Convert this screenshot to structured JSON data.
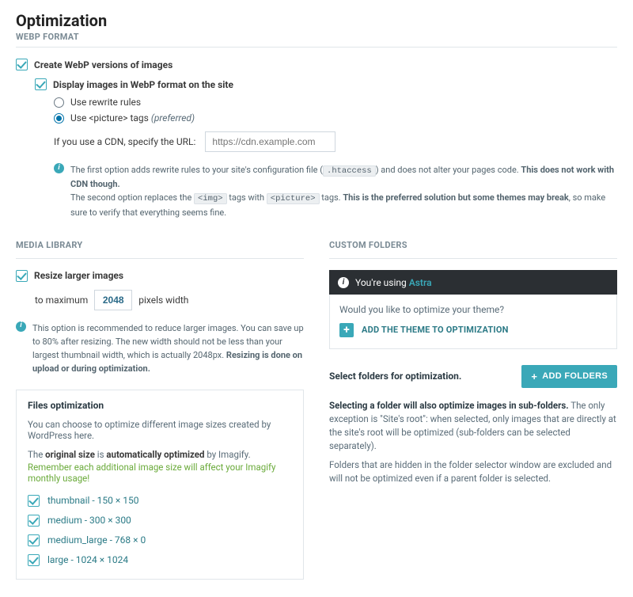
{
  "header": {
    "title": "Optimization",
    "webp_section": "WEBP FORMAT"
  },
  "webp": {
    "create_label": "Create WebP versions of images",
    "display_label": "Display images in WebP format on the site",
    "radio_rewrite": "Use rewrite rules",
    "radio_picture_pre": "Use ",
    "radio_picture_tag": "<picture>",
    "radio_picture_post": " tags ",
    "radio_picture_hint": "(preferred)",
    "cdn_label": "If you use a CDN, specify the URL:",
    "cdn_placeholder": "https://cdn.example.com",
    "info1_a": "The first option adds rewrite rules to your site's configuration file (",
    "info1_code": ".htaccess",
    "info1_b": ") and does not alter your pages code. ",
    "info1_c": "This does not work with CDN though.",
    "info2_a": "The second option replaces the ",
    "info2_img": "<img>",
    "info2_b": " tags with ",
    "info2_pic": "<picture>",
    "info2_c": " tags. ",
    "info2_d": "This is the preferred solution but some themes may break",
    "info2_e": ", so make sure to verify that everything seems fine."
  },
  "media": {
    "section": "MEDIA LIBRARY",
    "resize_label": "Resize larger images",
    "to_max": "to maximum",
    "value": "2048",
    "px_width": "pixels width",
    "info_a": "This option is recommended to reduce larger images. You can save up to 80% after resizing. The new width should not be less than your largest thumbnail width, which is actually 2048px. ",
    "info_b": "Resizing is done on upload or during optimization."
  },
  "files": {
    "title": "Files optimization",
    "line1": "You can choose to optimize different image sizes created by WordPress here.",
    "line2_a": "The ",
    "line2_b": "original size",
    "line2_c": " is ",
    "line2_d": "automatically optimized",
    "line2_e": " by Imagify.",
    "line3": "Remember each additional image size will affect your Imagify monthly usage!",
    "sizes": [
      {
        "label": "thumbnail - 150 × 150"
      },
      {
        "label": "medium - 300 × 300"
      },
      {
        "label": "medium_large - 768 × 0"
      },
      {
        "label": "large - 1024 × 1024"
      }
    ]
  },
  "custom": {
    "section": "CUSTOM FOLDERS",
    "using": "You're using ",
    "theme": "Astra",
    "question": "Would you like to optimize your theme?",
    "add_theme": "ADD THE THEME TO OPTIMIZATION",
    "select_label": "Select folders for optimization.",
    "add_folders": "ADD FOLDERS",
    "desc_a": "Selecting a folder will also optimize images in sub-folders.",
    "desc_b": " The only exception is \"Site's root\": when selected, only images that are directly at the site's root will be optimized (sub-folders can be selected separately).",
    "desc_c": "Folders that are hidden in the folder selector window are excluded and will not be optimized even if a parent folder is selected."
  }
}
